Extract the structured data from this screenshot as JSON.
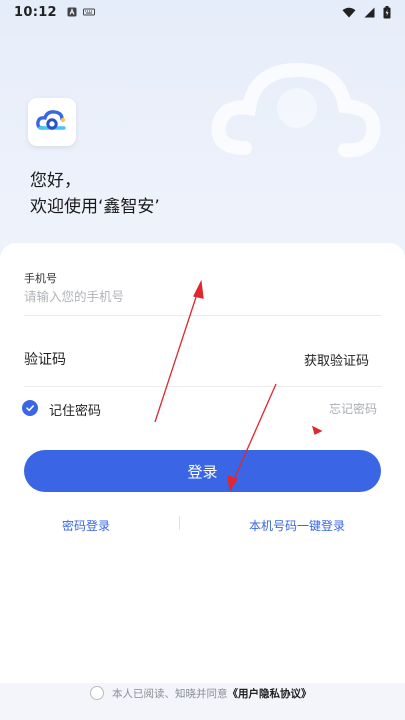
{
  "status_bar": {
    "time": "10:12"
  },
  "header": {
    "greeting_line1": "您好，",
    "greeting_line2": "欢迎使用‘鑫智安’"
  },
  "form": {
    "phone_label": "手机号",
    "phone_placeholder": "请输入您的手机号",
    "code_label": "验证码",
    "get_code": "获取验证码",
    "remember_label": "记住密码",
    "forgot_label": "忘记密码",
    "login_label": "登录"
  },
  "alt_login": {
    "password_login": "密码登录",
    "one_click_login": "本机号码一键登录"
  },
  "agreement": {
    "prefix": "本人已阅读、知晓并同意",
    "link": "《用户隐私协议》"
  },
  "colors": {
    "accent": "#3a66e6",
    "annotation": "#e0262f"
  }
}
